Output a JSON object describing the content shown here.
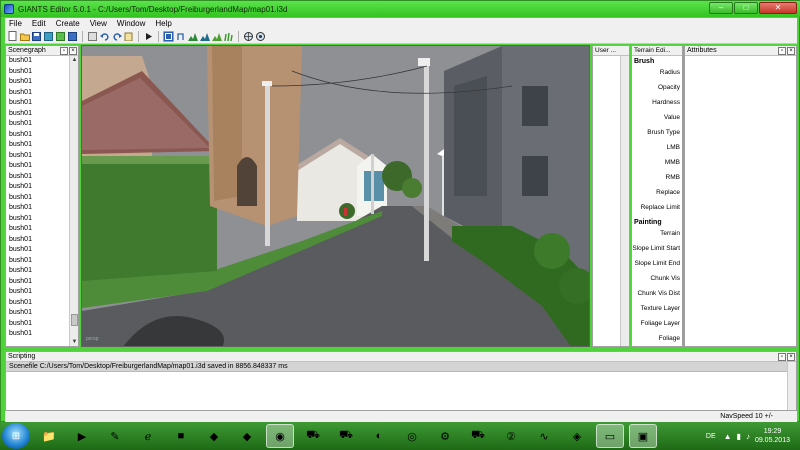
{
  "window": {
    "title": "GIANTS Editor 5.0.1 - C:/Users/Tom/Desktop/FreiburgerlandMap/map01.i3d",
    "minimize": "–",
    "maximize": "□",
    "close": "✕"
  },
  "menu": {
    "items": [
      "File",
      "Edit",
      "Create",
      "View",
      "Window",
      "Help"
    ]
  },
  "toolbar": {
    "icons": [
      "new-file-icon",
      "open-folder-icon",
      "save-icon",
      "save-all-icon",
      "export-icon",
      "import-icon",
      "cut-icon",
      "undo-icon",
      "redo-icon",
      "paste-icon",
      "play-icon",
      "select-tool-icon",
      "move-tool-icon",
      "terrain-sculpt-icon",
      "terrain-paint-icon",
      "foliage-paint-icon",
      "grass-paint-icon",
      "globe-icon",
      "globe-settings-icon"
    ]
  },
  "scenegraph": {
    "title": "Scenegraph",
    "items": [
      "bush01",
      "bush01",
      "bush01",
      "bush01",
      "bush01",
      "bush01",
      "bush01",
      "bush01",
      "bush01",
      "bush01",
      "bush01",
      "bush01",
      "bush01",
      "bush01",
      "bush01",
      "bush01",
      "bush01",
      "bush01",
      "bush01",
      "bush01",
      "bush01",
      "bush01",
      "bush01",
      "bush01",
      "bush01",
      "bush01",
      "bush01"
    ]
  },
  "viewport": {
    "watermark": "persp"
  },
  "user_panel": {
    "title": "User ..."
  },
  "terrain_panel": {
    "title": "Terrain Edi...",
    "brush_section": "Brush",
    "brush_fields": [
      "Radius",
      "Opacity",
      "Hardness",
      "Value",
      "Brush Type",
      "LMB",
      "MMB",
      "RMB",
      "Replace",
      "Replace Limit"
    ],
    "painting_section": "Painting",
    "painting_fields": [
      "Terrain",
      "Slope Limit Start",
      "Slope Limit End",
      "Chunk Vis",
      "Chunk Vis Dist",
      "Texture Layer",
      "Foliage Layer",
      "Foliage Channels"
    ]
  },
  "attributes_panel": {
    "title": "Attributes"
  },
  "scripting": {
    "title": "Scripting",
    "log": "Scenefile C:/Users/Tom/Desktop/FreiburgerlandMap/map01.i3d saved in 8856.848337 ms"
  },
  "status": {
    "nav_speed": "NavSpeed 10 +/-"
  },
  "taskbar": {
    "apps": [
      "explorer",
      "media-player",
      "pen-tool",
      "internet-explorer",
      "minecraft",
      "game-99",
      "game-2012",
      "chrome",
      "tractor-game",
      "harvester-game",
      "ccleaner",
      "blender",
      "steam",
      "farm-game",
      "app-2",
      "app-wave",
      "nvidia",
      "folder-app",
      "giants-editor"
    ],
    "language": "DE",
    "time": "19:29",
    "date": "09.05.2013"
  },
  "colors": {
    "window_frame": "#4fd23a",
    "taskbar": "#2a8a1a",
    "sky": "#8e9094",
    "road": "#5a5b5e",
    "grass": "#4f8c3a"
  }
}
